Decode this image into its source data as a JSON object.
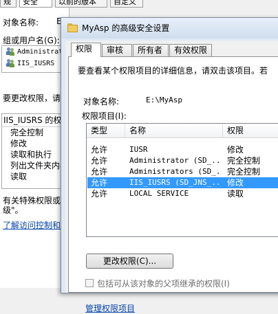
{
  "back_dialog": {
    "tabs": [
      "规",
      "安全",
      "以前的版本",
      "自定义"
    ],
    "object_name_label": "对象名称:",
    "object_name_value": "E",
    "groups_label": "组或用户名(G):",
    "users": [
      "Administrat",
      "IIS_IUSRS"
    ],
    "change_perm_text": "要更改权限，请",
    "perm_box_title": "IIS_IUSRS 的权限",
    "permissions": [
      "完全控制",
      "修改",
      "读取和执行",
      "列出文件夹内容",
      "读取"
    ],
    "special_text_1": "有关特殊权限或高",
    "special_text_2": "级\"。",
    "learn_link": "了解访问控制和权"
  },
  "dialog": {
    "title": "MyAsp 的高级安全设置",
    "tabs": [
      "权限",
      "审核",
      "所有者",
      "有效权限"
    ],
    "active_tab": "权限",
    "description": "要查看某个权限项目的详细信息，请双击该项目。若",
    "object_name_label": "对象名称:",
    "object_name_value": "E:\\MyAsp",
    "entries_label": "权限项目(I):",
    "columns": [
      "类型",
      "名称",
      "权限"
    ],
    "entries": [
      {
        "type": "允许",
        "name": "IUSR",
        "permission": "修改"
      },
      {
        "type": "允许",
        "name": "Administrator (SD_...",
        "permission": "完全控制"
      },
      {
        "type": "允许",
        "name": "Administrators (SD_...",
        "permission": "完全控制"
      },
      {
        "type": "允许",
        "name": "IIS_IUSRS (SD_JNS_...",
        "permission": "修改"
      },
      {
        "type": "允许",
        "name": "LOCAL SERVICE",
        "permission": "读取"
      }
    ],
    "selected_index": 3,
    "change_perm_button": "更改权限(C)...",
    "inherit_checkbox_label": "包括可从该对象的父项继承的权限(I)",
    "inherit_checked": false,
    "manage_link": "管理权限项目"
  },
  "colors": {
    "selection": "#3399ff",
    "link": "#0645ad",
    "title_gradient_top": "#e8f0fa",
    "folder": "#f1cc5e"
  }
}
